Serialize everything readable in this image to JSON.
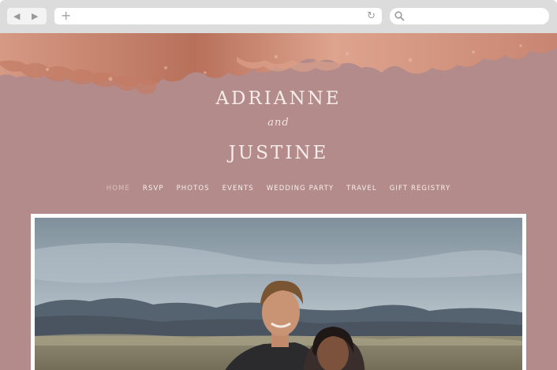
{
  "browser": {
    "back_icon": "back-arrow-icon",
    "forward_icon": "forward-arrow-icon",
    "new_tab_icon": "plus-icon",
    "reload_icon": "reload-icon",
    "search_icon": "search-icon"
  },
  "site": {
    "name_one": "ADRIANNE",
    "connector": "and",
    "name_two": "JUSTINE",
    "nav": [
      {
        "label": "HOME",
        "active": true
      },
      {
        "label": "RSVP"
      },
      {
        "label": "PHOTOS"
      },
      {
        "label": "EVENTS"
      },
      {
        "label": "WEDDING PARTY"
      },
      {
        "label": "TRAVEL"
      },
      {
        "label": "GIFT REGISTRY"
      }
    ],
    "colors": {
      "background": "#b38b8a",
      "foil": "#c9836a",
      "text": "#f6ecea"
    }
  }
}
